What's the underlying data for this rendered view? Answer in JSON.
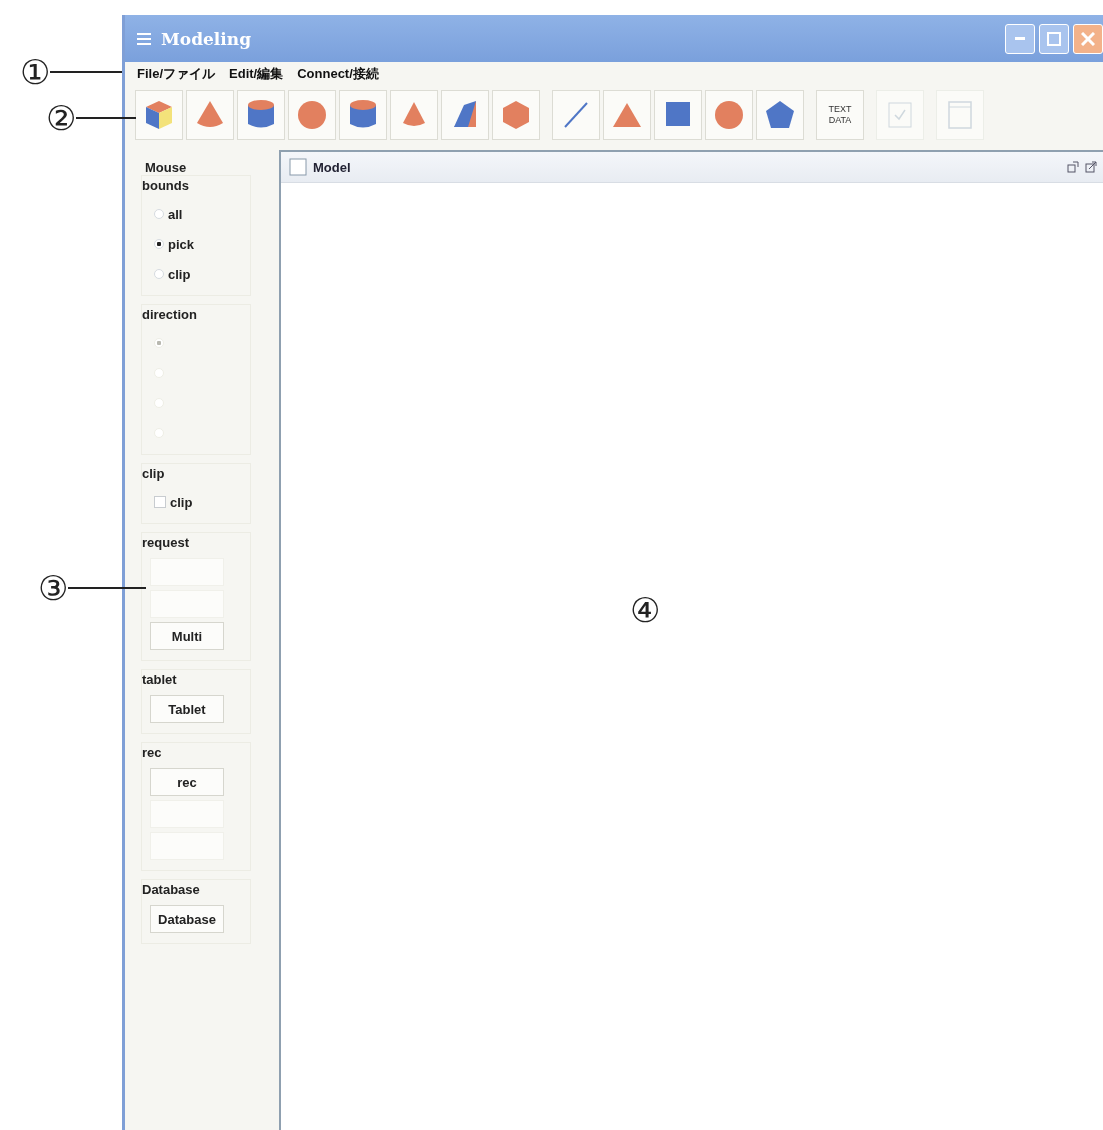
{
  "window": {
    "title": "Modeling"
  },
  "menu": [
    {
      "label": "File/ファイル"
    },
    {
      "label": "Edit/編集"
    },
    {
      "label": "Connect/接続"
    }
  ],
  "toolbar": [
    {
      "kind": "cube",
      "disabled": false
    },
    {
      "kind": "cone",
      "disabled": false
    },
    {
      "kind": "cylinder",
      "disabled": false
    },
    {
      "kind": "sphere",
      "disabled": false
    },
    {
      "kind": "cylinder",
      "disabled": false
    },
    {
      "kind": "pyramid",
      "disabled": false
    },
    {
      "kind": "wedge",
      "disabled": false
    },
    {
      "kind": "polyhedron",
      "disabled": false
    },
    {
      "kind": "line",
      "disabled": false
    },
    {
      "kind": "triangle",
      "disabled": false
    },
    {
      "kind": "square",
      "disabled": false
    },
    {
      "kind": "circle",
      "disabled": false
    },
    {
      "kind": "pentagon",
      "disabled": false
    },
    {
      "kind": "text",
      "label": "TEXT DATA",
      "disabled": false
    },
    {
      "kind": "check",
      "disabled": true
    },
    {
      "kind": "frame",
      "disabled": true
    }
  ],
  "sidebar": {
    "heading": "Mouse",
    "groups": [
      {
        "title": "bounds",
        "kind": "radio",
        "items": [
          {
            "label": "all",
            "selected": false,
            "disabled": false
          },
          {
            "label": "pick",
            "selected": true,
            "disabled": false
          },
          {
            "label": "clip",
            "selected": false,
            "disabled": false
          }
        ]
      },
      {
        "title": "direction",
        "kind": "radio",
        "items": [
          {
            "selected": true,
            "disabled": true
          },
          {
            "selected": false,
            "disabled": true
          },
          {
            "selected": false,
            "disabled": true
          },
          {
            "selected": false,
            "disabled": true
          }
        ]
      },
      {
        "title": "clip",
        "kind": "checkbox",
        "items": [
          {
            "label": "clip",
            "checked": false
          }
        ]
      },
      {
        "title": "request",
        "kind": "button",
        "items": [
          {
            "disabled": true
          },
          {
            "disabled": true
          },
          {
            "label": "Multi",
            "disabled": false
          }
        ]
      },
      {
        "title": "tablet",
        "kind": "button",
        "items": [
          {
            "label": "Tablet",
            "disabled": false
          }
        ]
      },
      {
        "title": "rec",
        "kind": "button",
        "items": [
          {
            "label": "rec",
            "disabled": false
          },
          {
            "disabled": true
          },
          {
            "disabled": true
          }
        ]
      },
      {
        "title": "Database",
        "kind": "button",
        "items": [
          {
            "label": "Database",
            "disabled": false
          }
        ]
      }
    ]
  },
  "model_frame": {
    "title": "Model"
  },
  "callouts": [
    {
      "label": "①"
    },
    {
      "label": "②"
    },
    {
      "label": "③"
    },
    {
      "label": "④"
    }
  ]
}
